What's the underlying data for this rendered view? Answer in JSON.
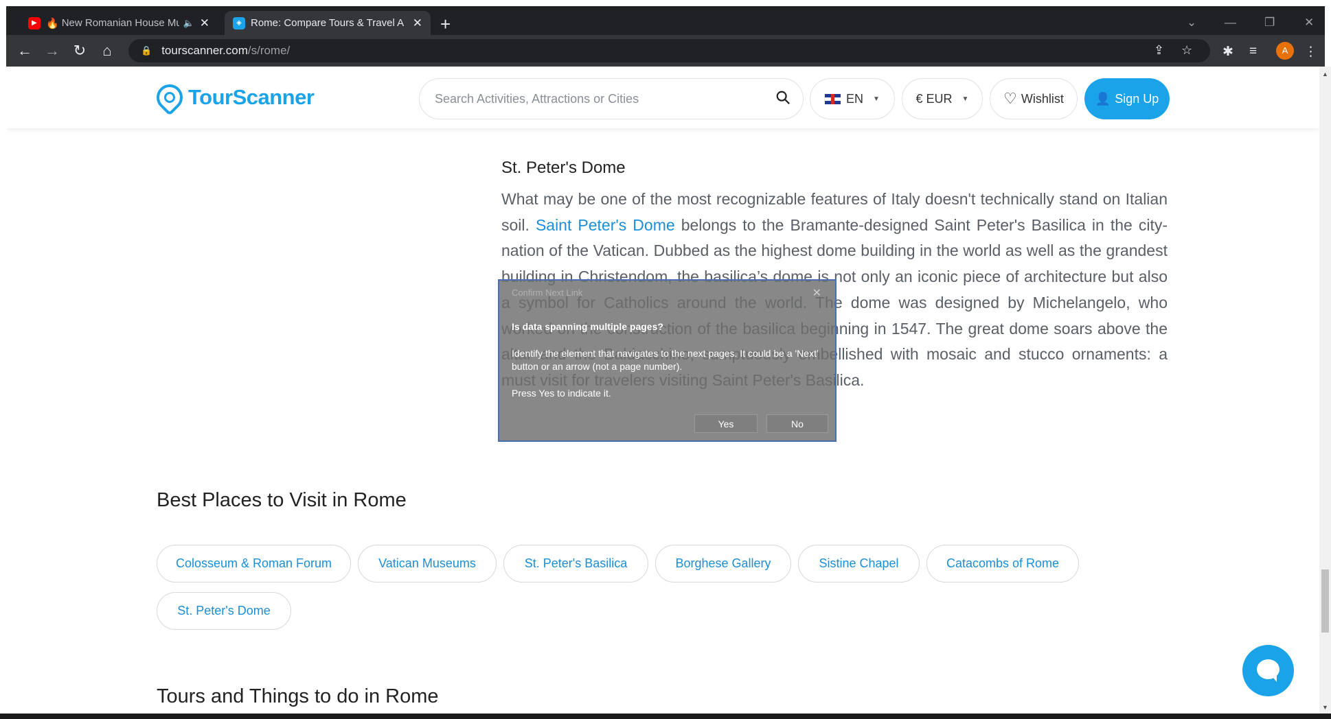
{
  "browser": {
    "tabs": [
      {
        "title": "New Romanian House Mu",
        "favicon": "youtube-icon",
        "active": false
      },
      {
        "title": "Rome: Compare Tours & Travel A",
        "favicon": "tourscanner-icon",
        "active": true
      }
    ],
    "url_host": "tourscanner.com",
    "url_path": "/s/rome/",
    "profile_initial": "A"
  },
  "header": {
    "logo": "TourScanner",
    "search_placeholder": "Search Activities, Attractions or Cities",
    "language": "EN",
    "currency": "€ EUR",
    "wishlist": "Wishlist",
    "signup": "Sign Up"
  },
  "content": {
    "dome_heading": "St. Peter's Dome",
    "dome_text_before_link": "What may be one of the most recognizable features of Italy doesn't technically stand on Italian soil. ",
    "dome_link": "Saint Peter's Dome",
    "dome_text_after_link": " belongs to the Bramante-designed Saint Peter's Basilica in the city-nation of the Vatican. Dubbed as the highest dome building in the world as well as the grandest building in Christendom, the basilica’s dome is not only an iconic piece of architecture but also a symbol for Catholics around the world. The dome was designed by Michelangelo, who worked on the construction of the basilica beginning in 1547. The great dome soars above the altar and the Baldacchino, sumptuously embellished with mosaic and stucco ornaments: a must visit for travelers visiting Saint Peter's Basilica.",
    "best_places_heading": "Best Places to Visit in Rome",
    "places": [
      "Colosseum & Roman Forum",
      "Vatican Museums",
      "St. Peter's Basilica",
      "Borghese Gallery",
      "Sistine Chapel",
      "Catacombs of Rome",
      "St. Peter's Dome"
    ],
    "tours_heading": "Tours and Things to do in Rome"
  },
  "dialog": {
    "title": "Confirm Next Link",
    "question": "Is data spanning multiple pages?",
    "description": "Identify the element that navigates to the next pages. It could be a 'Next' button or an arrow (not a page number).",
    "hint": "Press Yes to indicate it.",
    "yes": "Yes",
    "no": "No"
  },
  "colors": {
    "brand": "#1aa3e8",
    "link": "#1a8ed6",
    "chrome_dark": "#202124",
    "chrome_toolbar": "#35363a"
  }
}
